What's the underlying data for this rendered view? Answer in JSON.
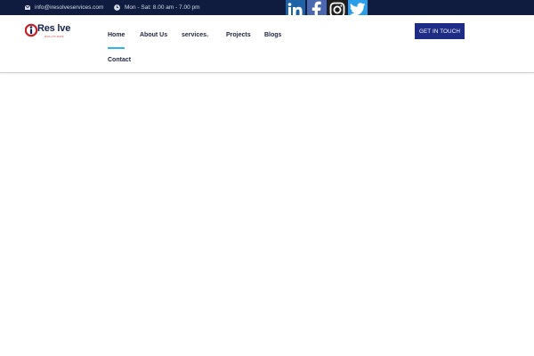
{
  "topbar": {
    "email": "info@iresolveservices.com",
    "hours": "Mon - Sat: 8.00 am - 7.00 pm",
    "social": [
      {
        "name": "linkedin",
        "icon": "linkedin-icon"
      },
      {
        "name": "facebook",
        "icon": "facebook-icon"
      },
      {
        "name": "instagram",
        "icon": "instagram-icon"
      },
      {
        "name": "twitter",
        "icon": "twitter-icon"
      }
    ]
  },
  "logo": {
    "text": "Res lve",
    "sub": "SOLUTIONS",
    "colors": {
      "red": "#c3202a",
      "blue": "#16224e"
    }
  },
  "nav": {
    "items": [
      {
        "label": "Home",
        "active": true
      },
      {
        "label": "About Us"
      },
      {
        "label": "services",
        "has_dropdown": true
      },
      {
        "label": "Projects"
      },
      {
        "label": "Blogs"
      },
      {
        "label": "Contact"
      }
    ]
  },
  "cta": {
    "label": "GET IN TOUCH"
  },
  "colors": {
    "topbar": "#0f1c3f",
    "accent": "#2fb6e8",
    "button": "#1f2c86"
  }
}
